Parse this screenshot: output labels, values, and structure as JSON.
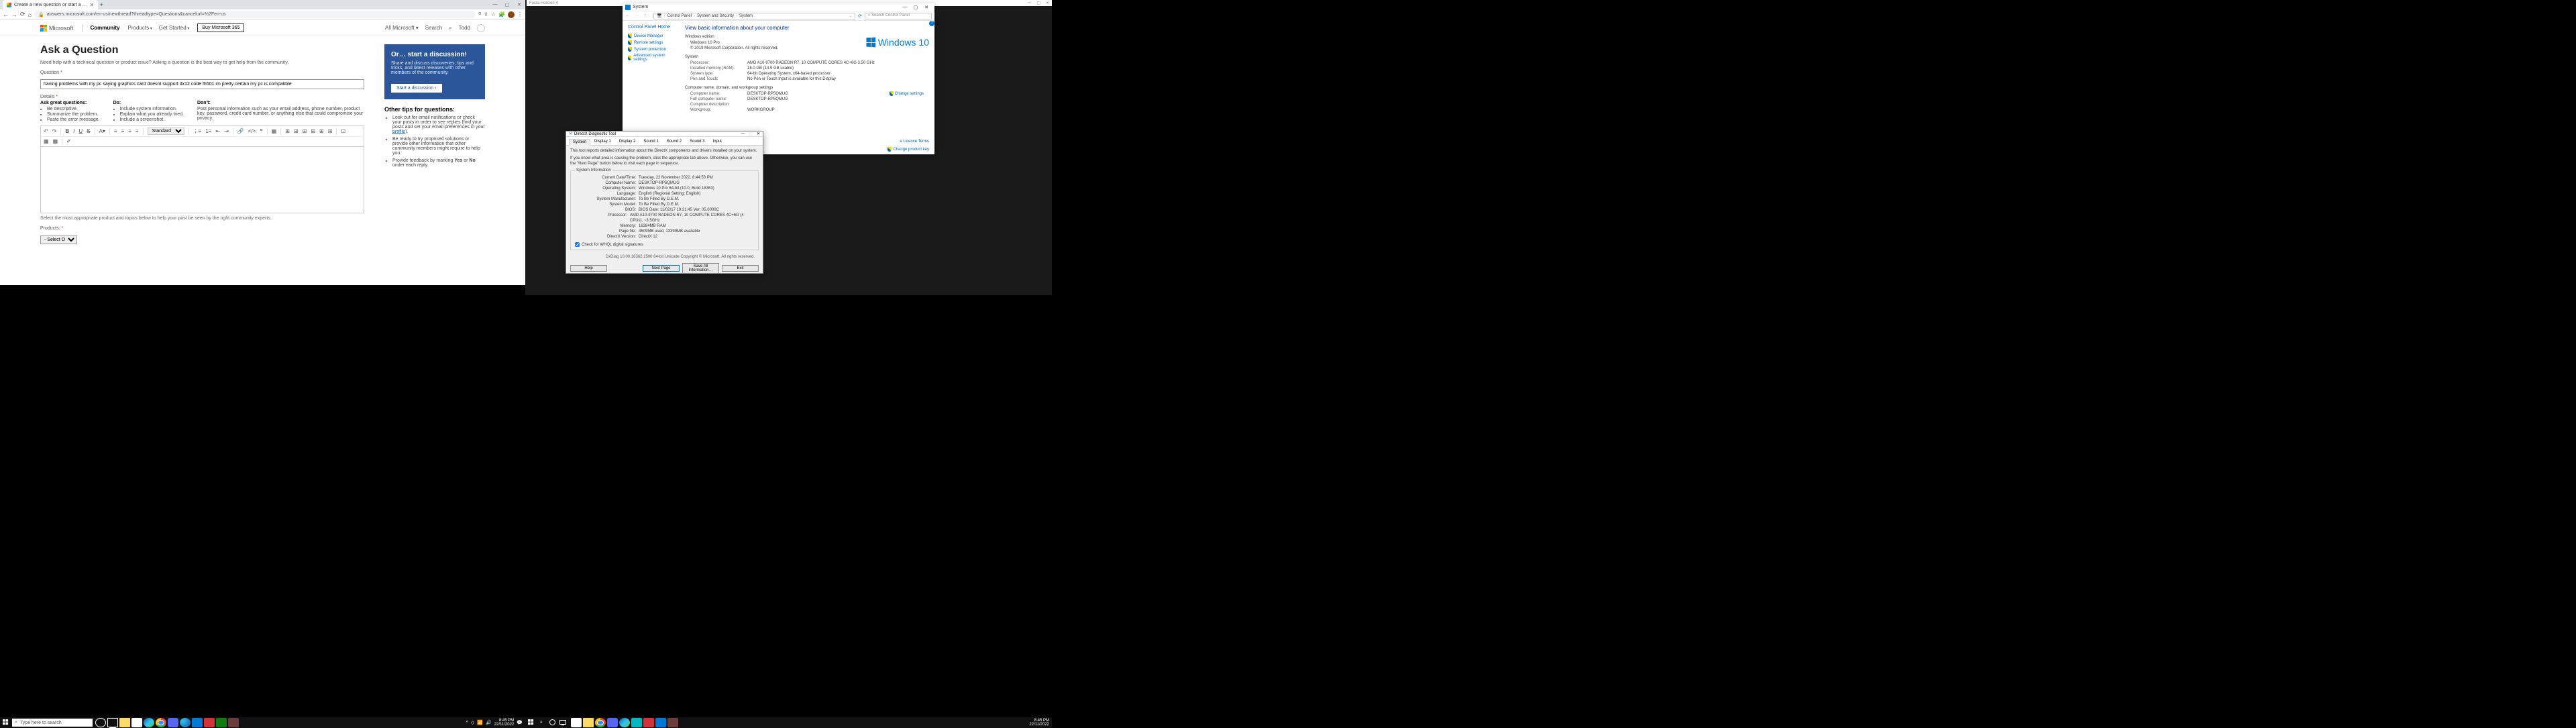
{
  "left": {
    "chrome": {
      "tab_title": "Create a new question or start a …",
      "url": "answers.microsoft.com/en-us/newthread?threadtype=Questions&cancelurl=%2Fen-us",
      "winctl": {
        "min": "—",
        "max": "▢",
        "close": "✕"
      }
    },
    "ms": {
      "logo": "Microsoft",
      "community": "Community",
      "nav": {
        "products": "Products",
        "getstarted": "Get Started"
      },
      "buy": "Buy Microsoft 365",
      "allms": "All Microsoft",
      "search": "Search",
      "user": "Todd",
      "h1": "Ask a Question",
      "sub": "Need help with a technical question or product issue? Asking a question is the best way to get help from the community.",
      "question_label": "Question",
      "required": "*",
      "question_value": "having problems with my pc saying graphics card doesnt support dx12 code fh501 im pretty certain my pc is compatible",
      "details_label": "Details",
      "good_h": "Ask great questions:",
      "good": [
        "Be descriptive.",
        "Summarize the problem.",
        "Paste the error message."
      ],
      "do_h": "Do:",
      "do": [
        "Include system information.",
        "Explain what you already tried.",
        "Include a screenshot."
      ],
      "dont_h": "Don't:",
      "dont": "Post personal information such as your email address, phone number, product key, password, credit card number, or anything else that could compromise your privacy.",
      "font_btn": "A",
      "style_select": "Standard",
      "hint": "Select the most appropriate product and topics below to help your post be seen by the right community experts.",
      "products_label": "Products:",
      "select_one": "- Select One -",
      "card_h": "Or… start a discussion!",
      "card_p": "Share and discuss discoveries, tips and tricks, and latest releases with other members of the community.",
      "card_btn": "Start a discussion ›",
      "tips_h": "Other tips for questions:",
      "tip1a": "Look out for email notifications or check your posts in order to see replies (find your posts and set your email preferences in your ",
      "tip1b": "profile",
      "tip1c": ").",
      "tip2": "Be ready to try proposed solutions or provide other information that other community members might require to help you.",
      "tip3a": "Provide feedback by marking ",
      "tip3b": "Yes",
      "tip3c": " or ",
      "tip3d": "No",
      "tip3e": " under each reply."
    },
    "taskbar": {
      "search_ph": "Type here to search",
      "time": "8:45 PM",
      "date": "22/11/2022"
    }
  },
  "right": {
    "forza": "Forza Horizon 4",
    "sys": {
      "title": "System",
      "crumb": [
        "Control Panel",
        "System and Security",
        "System"
      ],
      "search_ph": "Search Control Panel",
      "home": "Control Panel Home",
      "leftlinks": [
        "Device Manager",
        "Remote settings",
        "System protection",
        "Advanced system settings"
      ],
      "h2": "View basic information about your computer",
      "edition_h": "Windows edition",
      "edition": "Windows 10 Pro",
      "copyright": "© 2019 Microsoft Corporation. All rights reserved.",
      "winlogo": "Windows 10",
      "system_h": "System",
      "rows_sys": [
        {
          "k": "Processor:",
          "v": "AMD A10-9700 RADEON R7, 10 COMPUTE CORES 4C+6G   3.50 GHz"
        },
        {
          "k": "Installed memory (RAM):",
          "v": "16.0 GB (14.9 GB usable)"
        },
        {
          "k": "System type:",
          "v": "64-bit Operating System, x64-based processor"
        },
        {
          "k": "Pen and Touch:",
          "v": "No Pen or Touch Input is available for this Display"
        }
      ],
      "cnw_h": "Computer name, domain, and workgroup settings",
      "rows_cnw": [
        {
          "k": "Computer name:",
          "v": "DESKTOP-RP5QMUG"
        },
        {
          "k": "Full computer name:",
          "v": "DESKTOP-RP5QMUG"
        },
        {
          "k": "Computer description:",
          "v": ""
        },
        {
          "k": "Workgroup:",
          "v": "WORKGROUP"
        }
      ],
      "change_settings": "Change settings",
      "license": "e Licence Terms",
      "change_key": "Change product key"
    },
    "dx": {
      "title": "DirectX Diagnostic Tool",
      "tabs": [
        "System",
        "Display 1",
        "Display 2",
        "Sound 1",
        "Sound 2",
        "Sound 3",
        "Input"
      ],
      "intro1": "This tool reports detailed information about the DirectX components and drivers installed on your system.",
      "intro2": "If you know what area is causing the problem, click the appropriate tab above. Otherwise, you can use the \"Next Page\" button below to visit each page in sequence.",
      "fieldset": "System Information",
      "rows": [
        {
          "k": "Current Date/Time:",
          "v": "Tuesday, 22 November 2022, 8:44:53 PM"
        },
        {
          "k": "Computer Name:",
          "v": "DESKTOP-RP5QMUG"
        },
        {
          "k": "Operating System:",
          "v": "Windows 10 Pro 64-bit (10.0, Build 18363)"
        },
        {
          "k": "Language:",
          "v": "English (Regional Setting: English)"
        },
        {
          "k": "System Manufacturer:",
          "v": "To Be Filled By O.E.M."
        },
        {
          "k": "System Model:",
          "v": "To Be Filled By O.E.M."
        },
        {
          "k": "BIOS:",
          "v": "BIOS Date: 11/02/17 19:21:45 Ver: 05.0000C"
        },
        {
          "k": "Processor:",
          "v": "AMD A10-9700 RADEON R7, 10 COMPUTE CORES 4C+6G  (4 CPUs), ~3.5GHz"
        },
        {
          "k": "Memory:",
          "v": "16384MB RAM"
        },
        {
          "k": "Page file:",
          "v": "4509MB used, 13399MB available"
        },
        {
          "k": "DirectX Version:",
          "v": "DirectX 12"
        }
      ],
      "chk": "Check for WHQL digital signatures",
      "diag": "DxDiag 10.00.18362.1500 64-bit Unicode  Copyright © Microsoft. All rights reserved.",
      "btn_help": "Help",
      "btn_next": "Next Page",
      "btn_save": "Save All Information…",
      "btn_exit": "Exit"
    },
    "taskbar": {
      "time": "8:45 PM",
      "date": "22/11/2022"
    }
  }
}
